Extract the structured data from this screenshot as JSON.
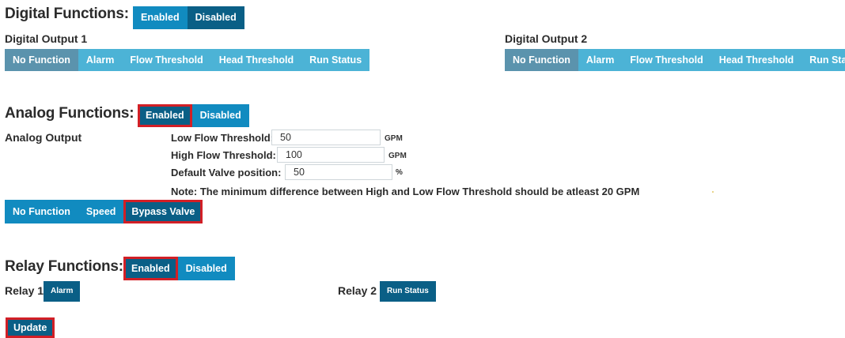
{
  "digital": {
    "title": "Digital Functions:",
    "toggle": [
      "Enabled",
      "Disabled"
    ],
    "output1_label": "Digital Output 1",
    "output2_label": "Digital Output 2",
    "options": [
      "No Function",
      "Alarm",
      "Flow Threshold",
      "Head Threshold",
      "Run Status"
    ]
  },
  "analog": {
    "title": "Analog Functions:",
    "toggle": [
      "Enabled",
      "Disabled"
    ],
    "output_label": "Analog Output",
    "low_flow_label": "Low Flow Threshold:",
    "low_flow_value": "50",
    "low_flow_unit": "GPM",
    "high_flow_label": "High Flow Threshold:",
    "high_flow_value": "100",
    "high_flow_unit": "GPM",
    "valve_label": "Default Valve position:",
    "valve_value": "50",
    "valve_unit": "%",
    "note": "Note: The minimum difference between High and Low Flow Threshold should be atleast 20 GPM",
    "options": [
      "No Function",
      "Speed",
      "Bypass Valve"
    ]
  },
  "relay": {
    "title": "Relay Functions:",
    "toggle": [
      "Enabled",
      "Disabled"
    ],
    "relay1_label": "Relay 1",
    "relay1_value": "Alarm",
    "relay2_label": "Relay 2",
    "relay2_value": "Run Status"
  },
  "update_label": "Update",
  "colors": {
    "light": "#4cb3d6",
    "mid": "#118bc0",
    "dark": "#0a5f86",
    "grey": "#5b93ad",
    "highlight": "#d21f26"
  }
}
